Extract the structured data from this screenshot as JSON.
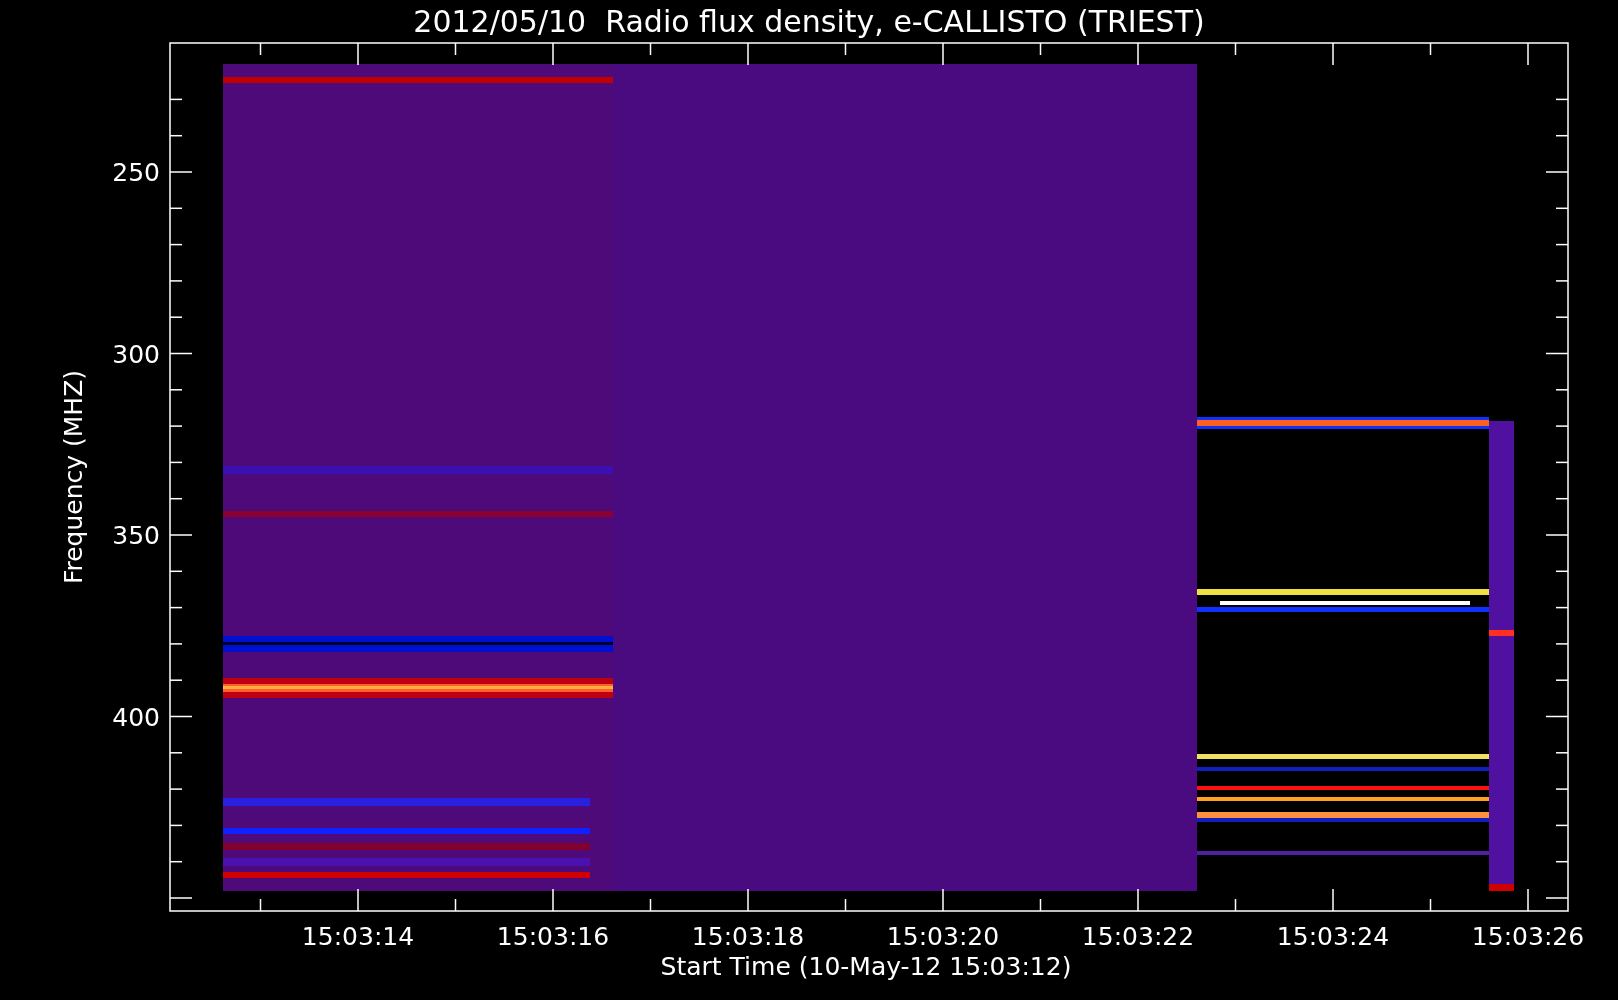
{
  "title": "2012/05/10  Radio flux density, e-CALLISTO (TRIEST)",
  "y_axis": {
    "label": "Frequency (MHZ)",
    "tick_labels": [
      "250",
      "300",
      "350",
      "400"
    ]
  },
  "x_axis": {
    "label": "Start Time (10-May-12 15:03:12)",
    "tick_labels": [
      "15:03:14",
      "15:03:16",
      "15:03:18",
      "15:03:20",
      "15:03:22",
      "15:03:24",
      "15:03:26"
    ]
  }
}
